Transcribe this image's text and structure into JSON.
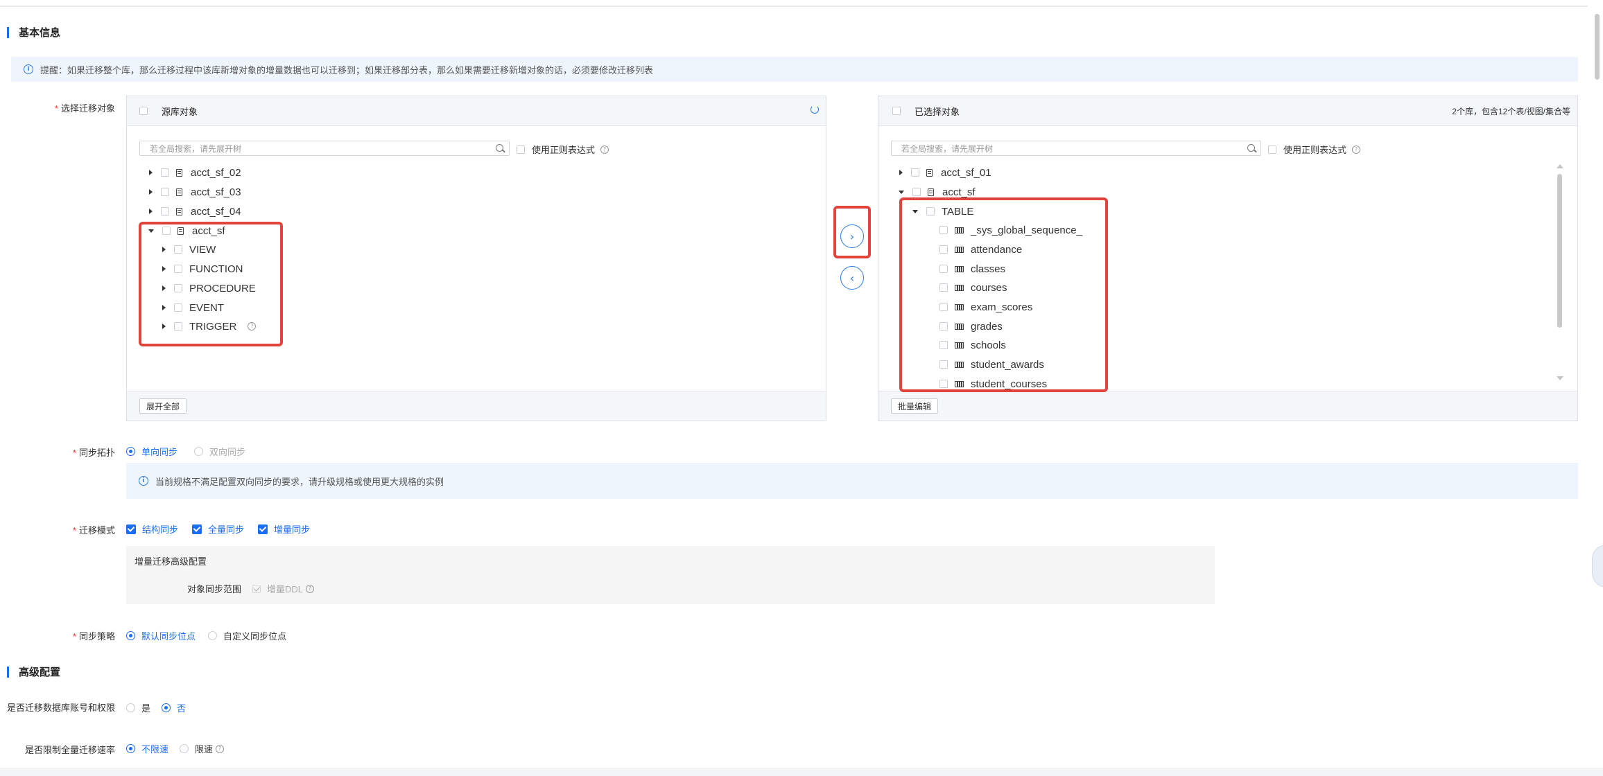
{
  "basic_info": {
    "title": "基本信息",
    "notice": "提醒：如果迁移整个库，那么迁移过程中该库新增对象的增量数据也可以迁移到；如果迁移部分表，那么如果需要迁移新增对象的话，必须要修改迁移列表"
  },
  "select_objects": {
    "label": "选择迁移对象",
    "source": {
      "header": "源库对象",
      "search_placeholder": "若全局搜索，请先展开树",
      "regex_label": "使用正则表达式",
      "tree": [
        {
          "name": "acct_sf_02"
        },
        {
          "name": "acct_sf_03"
        },
        {
          "name": "acct_sf_04"
        },
        {
          "name": "acct_sf"
        }
      ],
      "children": [
        "VIEW",
        "FUNCTION",
        "PROCEDURE",
        "EVENT",
        "TRIGGER"
      ],
      "footer_button": "展开全部"
    },
    "target": {
      "header": "已选择对象",
      "summary": "2个库，包含12个表/视图/集合等",
      "search_placeholder": "若全局搜索，请先展开树",
      "regex_label": "使用正则表达式",
      "databases": [
        "acct_sf_01",
        "acct_sf"
      ],
      "group": "TABLE",
      "tables": [
        "_sys_global_sequence_",
        "attendance",
        "classes",
        "courses",
        "exam_scores",
        "grades",
        "schools",
        "student_awards",
        "student_courses"
      ],
      "footer_button": "批量编辑"
    },
    "move_right_icon": "chevron-right-icon",
    "move_left_icon": "chevron-left-icon"
  },
  "sync_topology": {
    "label": "同步拓扑",
    "options": [
      "单向同步",
      "双向同步"
    ],
    "selected": "单向同步",
    "notice": "当前规格不满足配置双向同步的要求，请升级规格或使用更大规格的实例"
  },
  "migration_mode": {
    "label": "迁移模式",
    "options": [
      "结构同步",
      "全量同步",
      "增量同步"
    ],
    "advanced_title": "增量迁移高级配置",
    "scope_label": "对象同步范围",
    "scope_option": "增量DDL"
  },
  "sync_strategy": {
    "label": "同步策略",
    "options": [
      "默认同步位点",
      "自定义同步位点"
    ],
    "selected": "默认同步位点"
  },
  "advanced": {
    "title": "高级配置",
    "migrate_accounts": {
      "label": "是否迁移数据库账号和权限",
      "options": [
        "是",
        "否"
      ],
      "selected": "否"
    },
    "limit_rate": {
      "label": "是否限制全量迁移速率",
      "options": [
        "不限速",
        "限速"
      ],
      "selected": "不限速"
    }
  },
  "colors": {
    "accent": "#1a6cf5",
    "highlight_box": "#e2433d",
    "notice_bg": "#eef5fd"
  }
}
